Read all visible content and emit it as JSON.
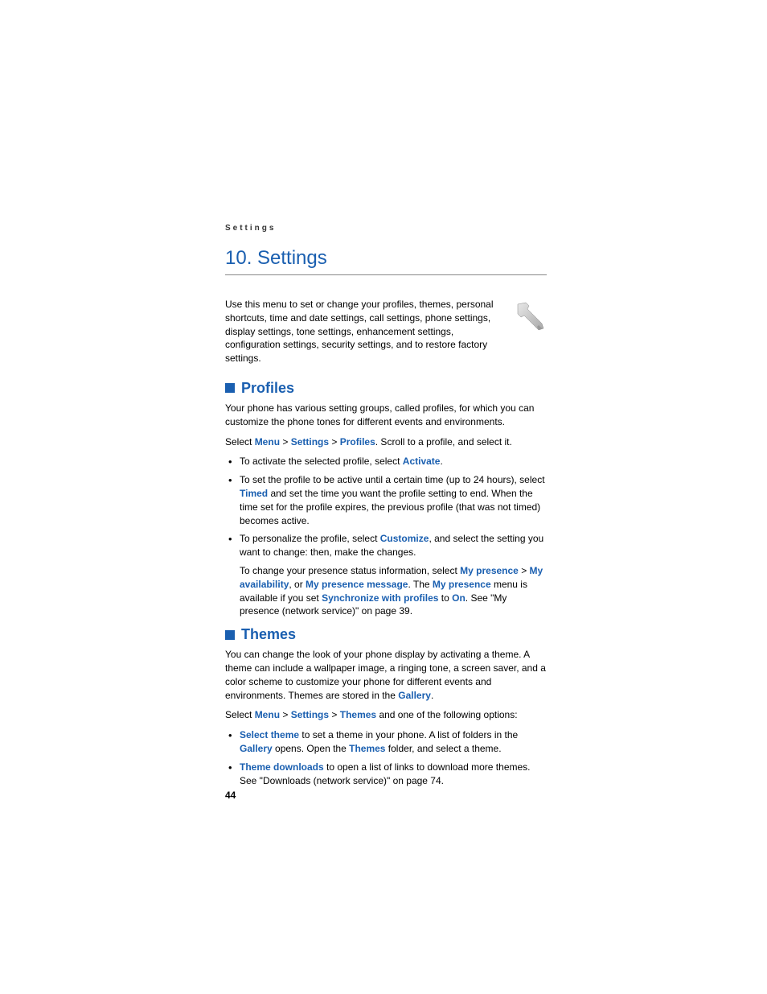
{
  "runningHeader": "Settings",
  "chapterTitle": "10. Settings",
  "intro": "Use this menu to set or change your profiles, themes, personal shortcuts, time and date settings, call settings, phone settings, display settings, tone settings, enhancement settings, configuration settings, security settings, and to restore factory settings.",
  "profiles": {
    "title": "Profiles",
    "p1": "Your phone has various setting groups, called profiles, for which you can customize the phone tones for different events and environments.",
    "p2_prefix": "Select ",
    "p2_menu": "Menu",
    "p2_gt1": " > ",
    "p2_settings": "Settings",
    "p2_gt2": " > ",
    "p2_profiles": "Profiles",
    "p2_suffix": ". Scroll to a profile, and select it.",
    "b1_prefix": "To activate the selected profile, select ",
    "b1_activate": "Activate",
    "b1_suffix": ".",
    "b2_prefix": "To set the profile to be active until a certain time (up to 24 hours), select ",
    "b2_timed": "Timed",
    "b2_suffix": " and set the time you want the profile setting to end. When the time set for the profile expires, the previous profile (that was not timed) becomes active.",
    "b3_prefix": "To personalize the profile, select ",
    "b3_customize": "Customize",
    "b3_suffix": ", and select the setting you want to change: then, make the changes.",
    "b3b_prefix": "To change your presence status information, select  ",
    "b3b_mypresence": "My presence",
    "b3b_gt": " > ",
    "b3b_myavail": "My availability",
    "b3b_mid1": ", or ",
    "b3b_mypresmsg": "My presence message",
    "b3b_mid2": ". The ",
    "b3b_mypresence2": "My presence",
    "b3b_mid3": " menu is available if you set ",
    "b3b_sync": "Synchronize with profiles",
    "b3b_mid4": " to ",
    "b3b_on": "On",
    "b3b_suffix": ". See \"My presence (network service)\" on page 39."
  },
  "themes": {
    "title": "Themes",
    "p1_prefix": "You can change the look of your phone display by activating a theme. A theme can include a wallpaper image, a ringing tone, a screen saver, and a color scheme to customize your phone for different events and environments. Themes are stored in the ",
    "p1_gallery": "Gallery",
    "p1_suffix": ".",
    "p2_prefix": "Select ",
    "p2_menu": "Menu",
    "p2_gt1": " > ",
    "p2_settings": "Settings",
    "p2_gt2": " > ",
    "p2_themes": "Themes",
    "p2_suffix": " and one of the following options:",
    "b1_select": "Select theme",
    "b1_mid1": " to set a theme in your phone. A list of folders in the ",
    "b1_gallery": "Gallery",
    "b1_mid2": " opens. Open the ",
    "b1_themes": "Themes",
    "b1_suffix": " folder, and select a theme.",
    "b2_dl": "Theme downloads",
    "b2_suffix": " to open a list of links to download more themes. See \"Downloads (network service)\" on page 74."
  },
  "pageNumber": "44"
}
